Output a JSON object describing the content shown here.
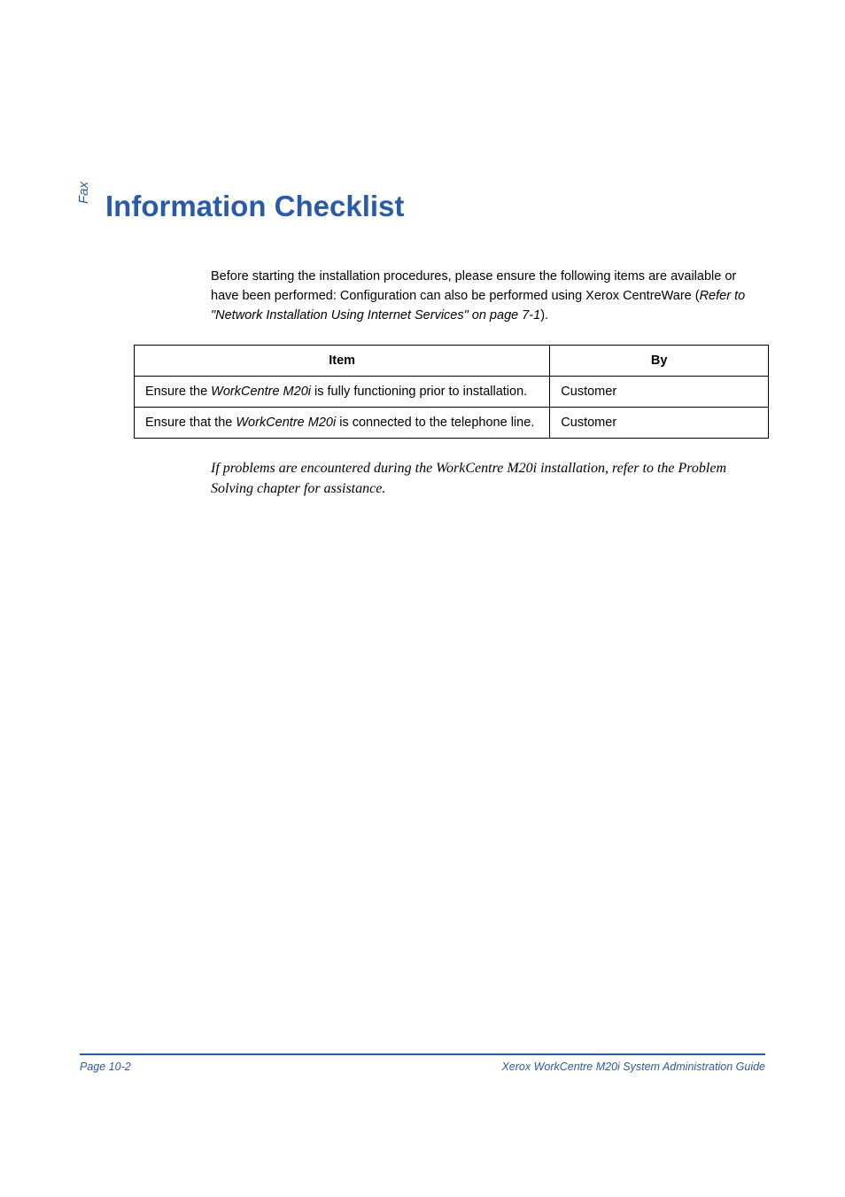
{
  "side_label": "Fax",
  "title": "Information Checklist",
  "intro": {
    "pre": "Before starting the installation procedures, please ensure the following items are available or have been performed: Configuration can also be performed using Xerox CentreWare (",
    "ref": "Refer to \"Network Installation Using Internet Services\" on page 7-1",
    "post": ")."
  },
  "table": {
    "header_item": "Item",
    "header_by": "By",
    "rows": [
      {
        "pre": "Ensure the ",
        "product": "WorkCentre M20i",
        "post": " is fully functioning prior to installation.",
        "by": "Customer"
      },
      {
        "pre": "Ensure that the ",
        "product": "WorkCentre M20i",
        "post": " is connected to the telephone line.",
        "by": "Customer"
      }
    ]
  },
  "note": "If problems are encountered during the WorkCentre M20i installation, refer to the Problem Solving chapter for assistance.",
  "footer": {
    "left": "Page 10-2",
    "right": "Xerox WorkCentre M20i System Administration Guide"
  }
}
